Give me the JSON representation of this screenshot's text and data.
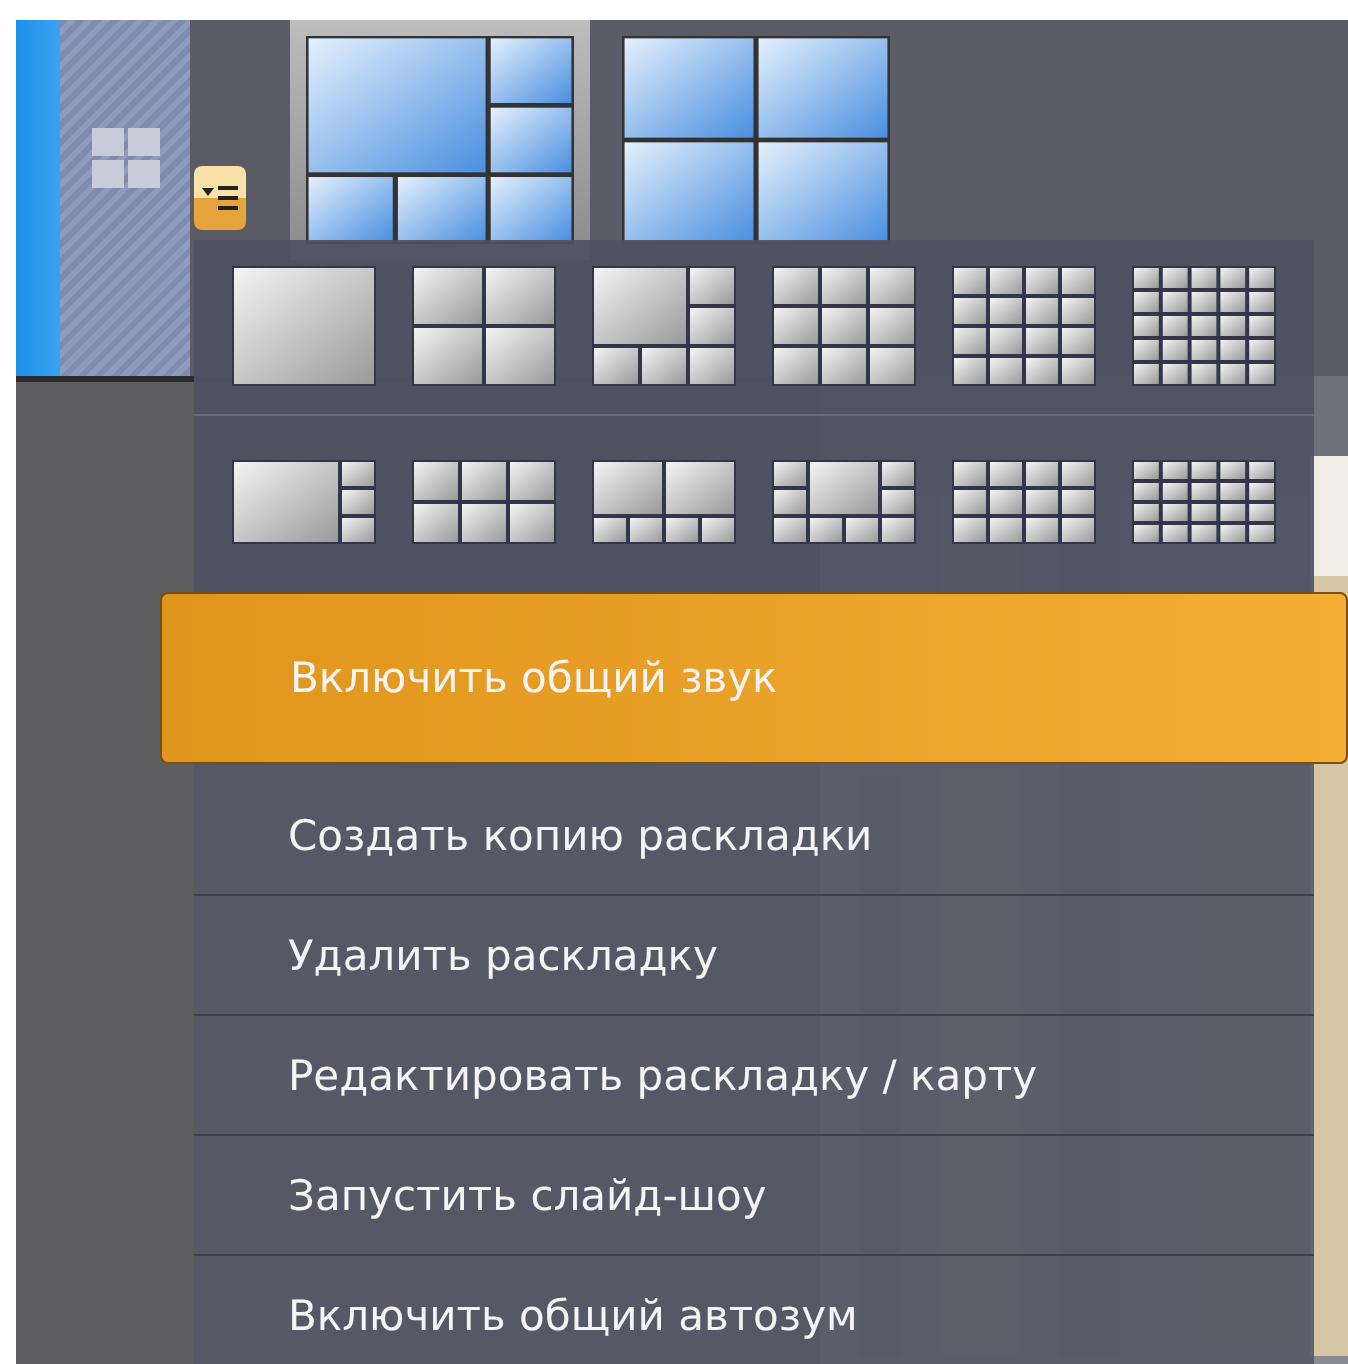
{
  "layout_thumbnails": [
    {
      "selected": true
    },
    {
      "selected": false
    }
  ],
  "menu": {
    "items": [
      {
        "label": "Включить общий звук",
        "selected": true
      },
      {
        "label": "Создать копию раскладки",
        "selected": false
      },
      {
        "label": "Удалить раскладку",
        "selected": false
      },
      {
        "label": "Редактировать раскладку / карту",
        "selected": false
      },
      {
        "label": "Запустить слайд-шоу",
        "selected": false
      },
      {
        "label": "Включить общий автозум",
        "selected": false
      }
    ]
  }
}
